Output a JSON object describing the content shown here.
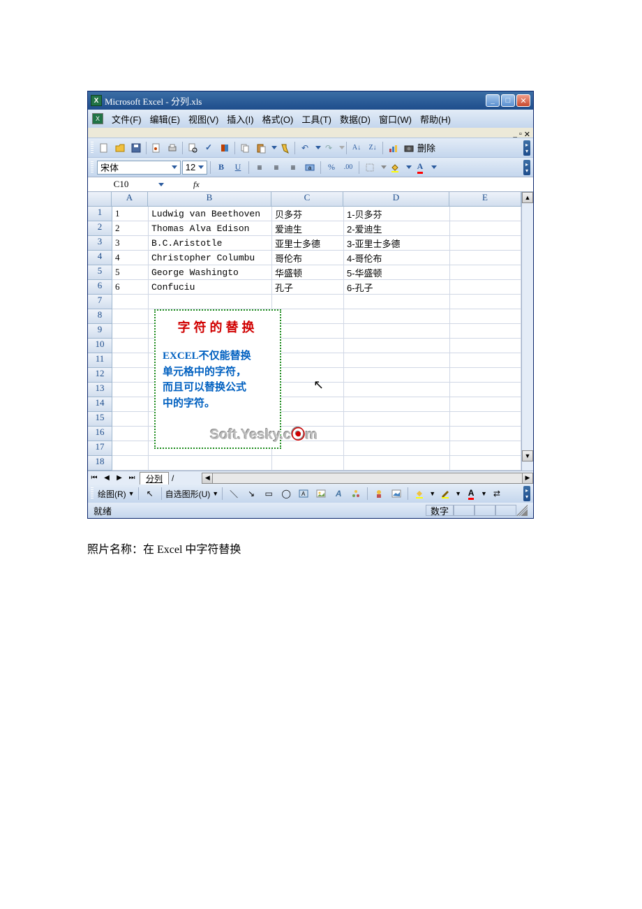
{
  "title": "Microsoft Excel - 分列.xls",
  "menu": {
    "file": "文件(F)",
    "edit": "编辑(E)",
    "view": "视图(V)",
    "insert": "插入(I)",
    "format": "格式(O)",
    "tools": "工具(T)",
    "data": "数据(D)",
    "window": "窗口(W)",
    "help": "帮助(H)"
  },
  "font": {
    "name": "宋体",
    "size": "12"
  },
  "namebox": "C10",
  "fx": "fx",
  "toolbar": {
    "delete": "删除"
  },
  "columns": [
    "A",
    "B",
    "C",
    "D",
    "E"
  ],
  "rows": [
    {
      "n": "1",
      "a": "1",
      "b": "Ludwig van Beethoven",
      "c": "贝多芬",
      "d": "1-贝多芬"
    },
    {
      "n": "2",
      "a": "2",
      "b": "Thomas Alva Edison",
      "c": "爱迪生",
      "d": "2-爱迪生"
    },
    {
      "n": "3",
      "a": "3",
      "b": "B.C.Aristotle",
      "c": "亚里士多德",
      "d": "3-亚里士多德"
    },
    {
      "n": "4",
      "a": "4",
      "b": "Christopher Columbu",
      "c": "哥伦布",
      "d": "4-哥伦布"
    },
    {
      "n": "5",
      "a": "5",
      "b": "George Washingto",
      "c": "华盛顿",
      "d": "5-华盛顿"
    },
    {
      "n": "6",
      "a": "6",
      "b": "Confuciu",
      "c": "孔子",
      "d": "6-孔子"
    },
    {
      "n": "7",
      "a": "",
      "b": "",
      "c": "",
      "d": ""
    },
    {
      "n": "8",
      "a": "",
      "b": "",
      "c": "",
      "d": ""
    },
    {
      "n": "9",
      "a": "",
      "b": "",
      "c": "",
      "d": ""
    },
    {
      "n": "10",
      "a": "",
      "b": "",
      "c": "",
      "d": ""
    },
    {
      "n": "11",
      "a": "",
      "b": "",
      "c": "",
      "d": ""
    },
    {
      "n": "12",
      "a": "",
      "b": "",
      "c": "",
      "d": ""
    },
    {
      "n": "13",
      "a": "",
      "b": "",
      "c": "",
      "d": ""
    },
    {
      "n": "14",
      "a": "",
      "b": "",
      "c": "",
      "d": ""
    },
    {
      "n": "15",
      "a": "",
      "b": "",
      "c": "",
      "d": ""
    },
    {
      "n": "16",
      "a": "",
      "b": "",
      "c": "",
      "d": ""
    },
    {
      "n": "17",
      "a": "",
      "b": "",
      "c": "",
      "d": ""
    },
    {
      "n": "18",
      "a": "",
      "b": "",
      "c": "",
      "d": ""
    }
  ],
  "overlay": {
    "title": "字符的替换",
    "line1": "EXCEL不仅能替换",
    "line2": "单元格中的字符，",
    "line3": "而且可以替换公式",
    "line4": "中的字符。"
  },
  "watermark": {
    "a": "Soft.Yesky.c",
    "b": "m"
  },
  "sheet_tabs": {
    "name": "分列"
  },
  "draw": {
    "menu": "绘图(R)",
    "shapes": "自选图形(U)"
  },
  "status": {
    "ready": "就绪",
    "mode": "数字"
  },
  "caption": "照片名称：在 Excel 中字符替换"
}
